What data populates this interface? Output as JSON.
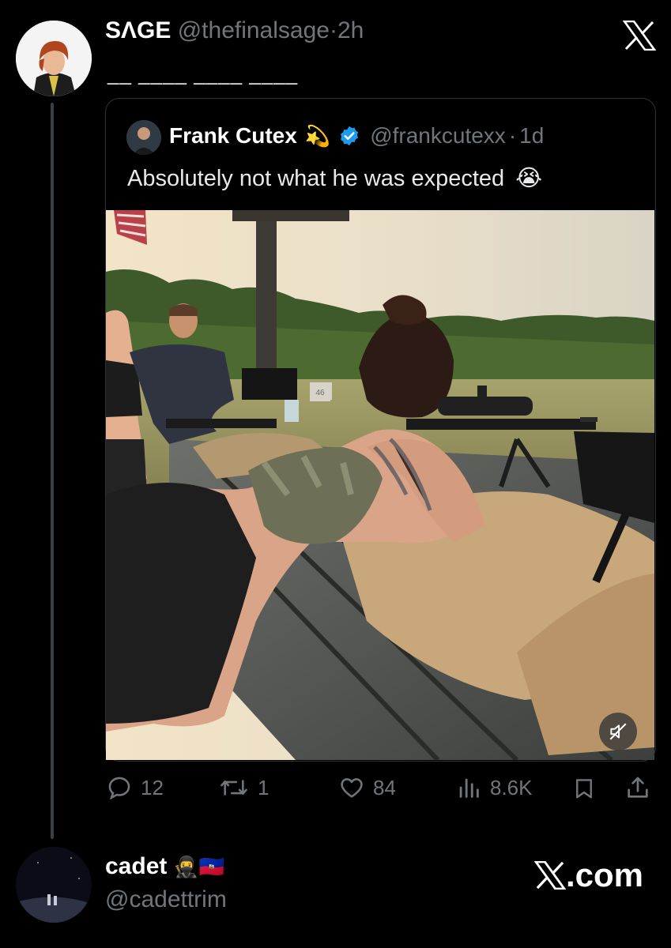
{
  "post": {
    "display_name": "SΛGE",
    "handle": "@thefinalsage",
    "separator": "·",
    "time": "2h",
    "text": "__ ____ ____ ____"
  },
  "quote": {
    "display_name": "Frank Cutex",
    "name_emoji": "💫",
    "handle": "@frankcutexx",
    "separator": "·",
    "time": "1d",
    "text": "Absolutely not what he was expected",
    "text_emoji": "😭",
    "media_sign": "46"
  },
  "actions": {
    "replies": "12",
    "reposts": "1",
    "likes": "84",
    "views": "8.6K"
  },
  "watermark": {
    "account_name": "cadet",
    "account_emojis": "🥷🇭🇹",
    "account_handle": "@cadettrim",
    "site_label": ".com"
  },
  "colors": {
    "background": "#000000",
    "text": "#e7e9ea",
    "muted": "#71767b",
    "verified": "#1d9bf0",
    "border": "#2f3336"
  },
  "icons": [
    "close-x-icon",
    "verified-icon",
    "mute-icon",
    "reply-icon",
    "repost-icon",
    "like-icon",
    "views-icon",
    "bookmark-icon",
    "share-icon",
    "x-logo-icon"
  ]
}
